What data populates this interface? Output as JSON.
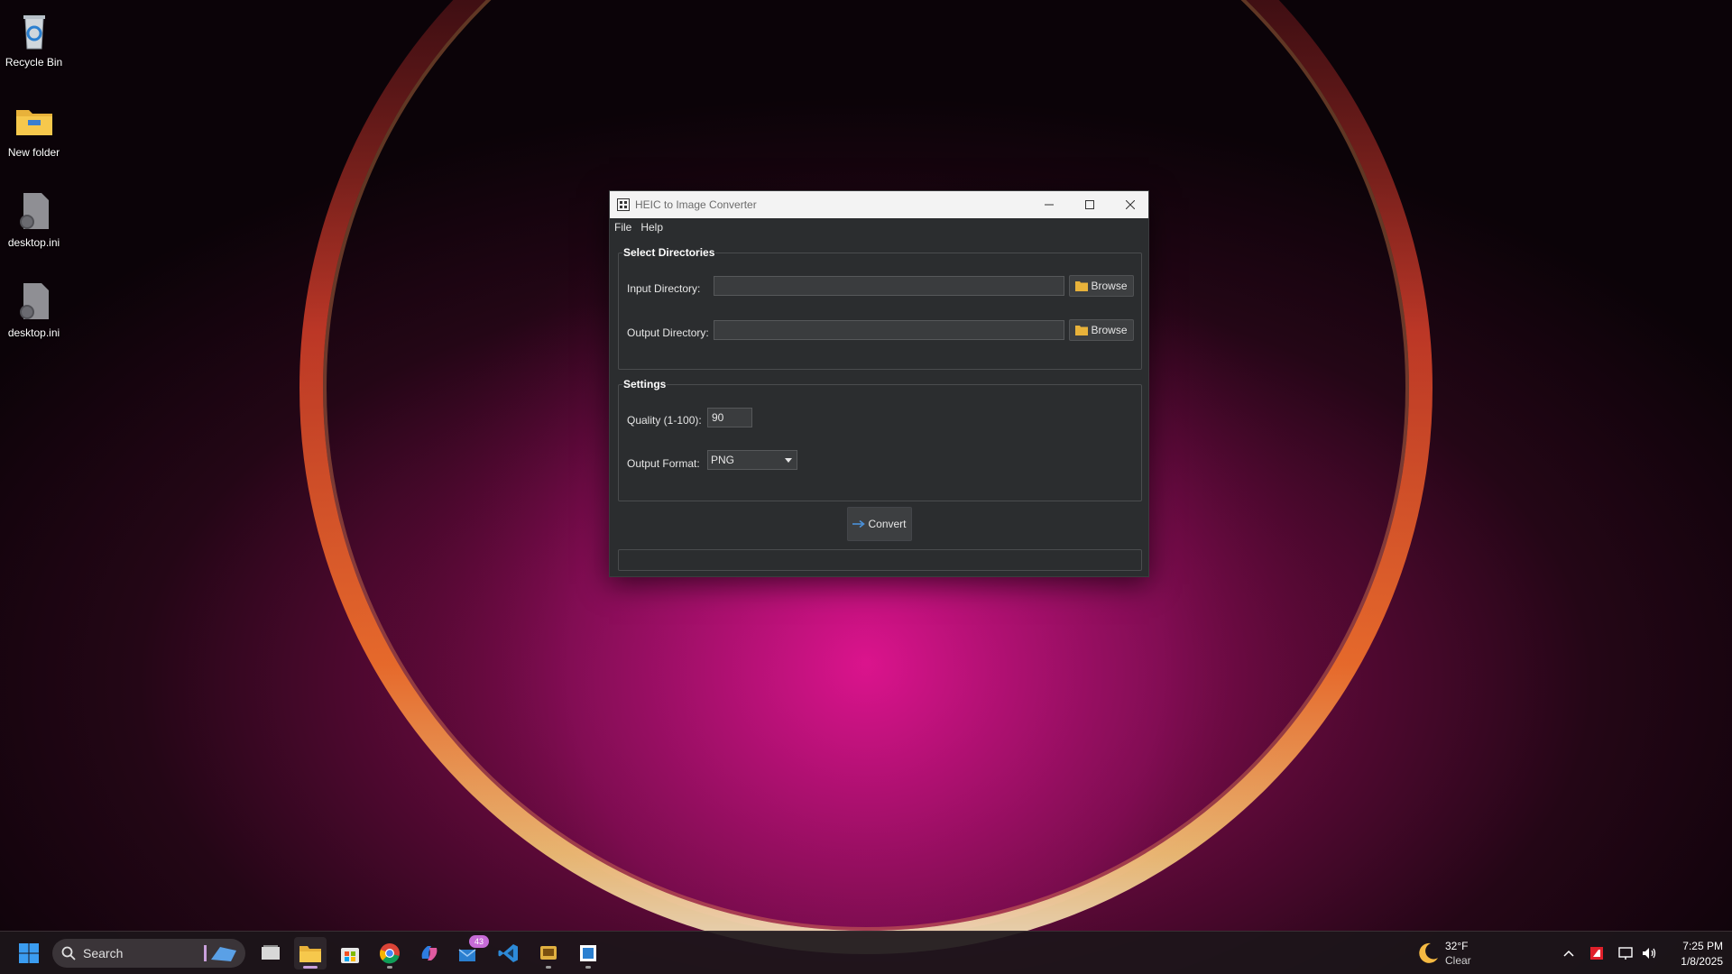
{
  "desktop": {
    "icons": [
      {
        "label": "Recycle Bin",
        "icon": "recycle-bin-icon"
      },
      {
        "label": "New folder",
        "icon": "folder-icon"
      },
      {
        "label": "desktop.ini",
        "icon": "settings-file-icon"
      },
      {
        "label": "desktop.ini",
        "icon": "settings-file-icon"
      }
    ]
  },
  "window": {
    "title": "HEIC to Image Converter",
    "menu": [
      "File",
      "Help"
    ],
    "directories": {
      "title": "Select Directories",
      "input_label": "Input Directory:",
      "input_value": "",
      "output_label": "Output Directory:",
      "output_value": "",
      "browse_label": "Browse"
    },
    "settings": {
      "title": "Settings",
      "quality_label": "Quality (1-100):",
      "quality_value": "90",
      "format_label": "Output Format:",
      "format_value": "PNG"
    },
    "convert_label": "Convert",
    "status_text": ""
  },
  "taskbar": {
    "search_label": "Search",
    "badge_count": "43",
    "weather_temp": "32°F",
    "weather_desc": "Clear",
    "time": "7:25 PM",
    "date": "1/8/2025"
  },
  "colors": {
    "window_bg": "#2b2d2f",
    "titlebar_bg": "#f3f3f3",
    "accent": "#4a90d9"
  }
}
